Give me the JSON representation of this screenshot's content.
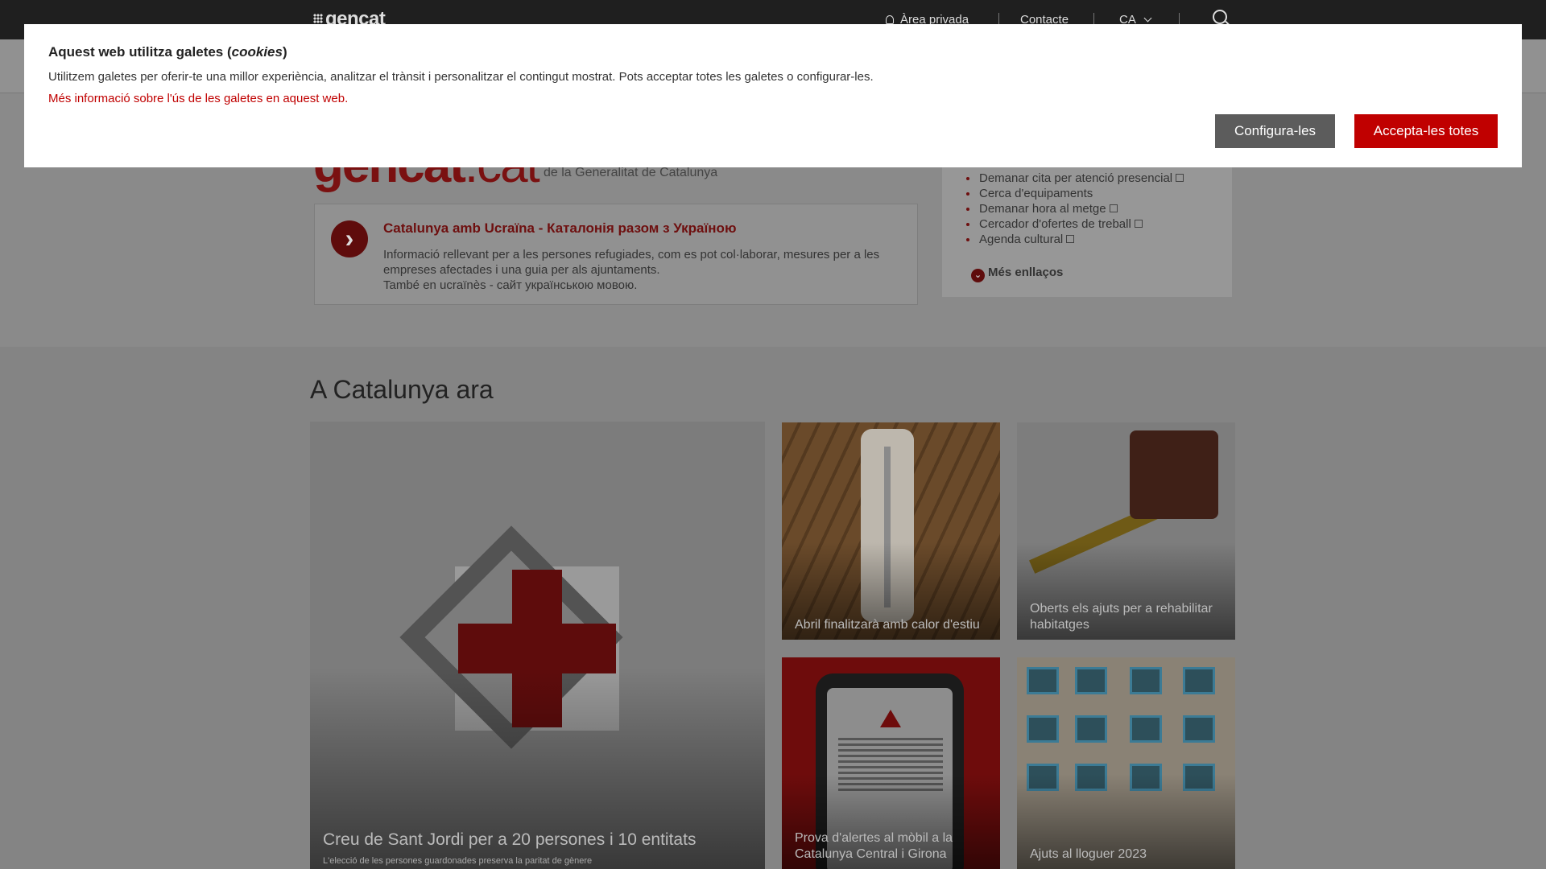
{
  "topbar": {
    "logo": "gencat",
    "nav_private": "Àrea privada",
    "nav_contact": "Contacte",
    "nav_lang": "CA"
  },
  "brand": {
    "name": "gencat",
    "tld": ".cat",
    "subtitle": "de la Generalitat de Catalunya"
  },
  "ukraine": {
    "title": "Catalunya amb Ucraïna - Каталонія разом з Україною",
    "text1": "Informació rellevant per a les persones refugiades, com es pot col·laborar, mesures per a les empreses afectades i una guia per als ajuntaments.",
    "text2": "També en ucraïnès - сайт українською мовою."
  },
  "links": {
    "items": [
      "Demanar cita per atenció presencial",
      "Cerca d'equipaments",
      "Demanar hora al metge",
      "Cercador d'ofertes de treball",
      "Agenda cultural"
    ],
    "more": "Més enllaços"
  },
  "section": {
    "title": "A Catalunya ara",
    "cards": [
      {
        "title": "Creu de Sant Jordi per a 20 persones i 10 entitats",
        "subtitle": "L'elecció de les persones guardonades preserva la paritat de gènere"
      },
      {
        "title": "Abril finalitzarà amb calor d'estiu"
      },
      {
        "title": "Oberts els ajuts per a rehabilitar habitatges"
      },
      {
        "title": "Prova d'alertes al mòbil a la Catalunya Central i Girona"
      },
      {
        "title": "Ajuts al lloguer 2023"
      }
    ]
  },
  "cookies": {
    "title_pre": "Aquest web utilitza galetes (",
    "title_em": "cookies",
    "title_post": ")",
    "text": "Utilitzem galetes per oferir-te una millor experiència, analitzar el trànsit i personalitzar el contingut mostrat. Pots acceptar totes les galetes o configurar-les.",
    "link": "Més informació sobre l'ús de les galetes en aquest web.",
    "configure": "Configura-les",
    "accept": "Accepta-les totes"
  },
  "colors": {
    "accent": "#c00000",
    "button_secondary": "#5c5c5c",
    "topbar": "#1f1f1f"
  }
}
